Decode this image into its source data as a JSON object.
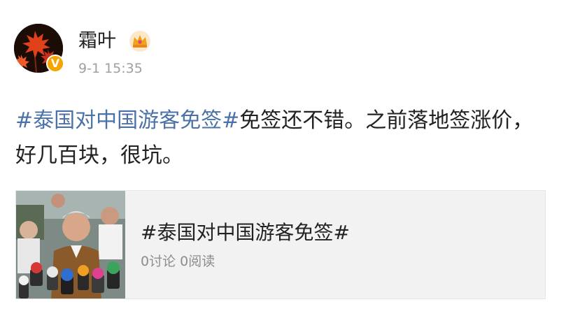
{
  "post": {
    "author": {
      "name": "霜叶",
      "verified_badge": "V",
      "avatar_icon": "maple-leaf-avatar",
      "member_icon": "crown-icon"
    },
    "timestamp": "9-1 15:35",
    "hashtag": "#泰国对中国游客免签#",
    "body": "免签还不错。之前落地签涨价，好几百块，很坑。"
  },
  "topic_card": {
    "title": "#泰国对中国游客免签#",
    "stats": "0讨论 0阅读",
    "thumbnail": "press-conference-photo"
  },
  "colors": {
    "hashtag": "#4a72a8",
    "timestamp": "#a0a0a0",
    "badge": "#f5a400",
    "card_background": "#f2f2f2"
  }
}
